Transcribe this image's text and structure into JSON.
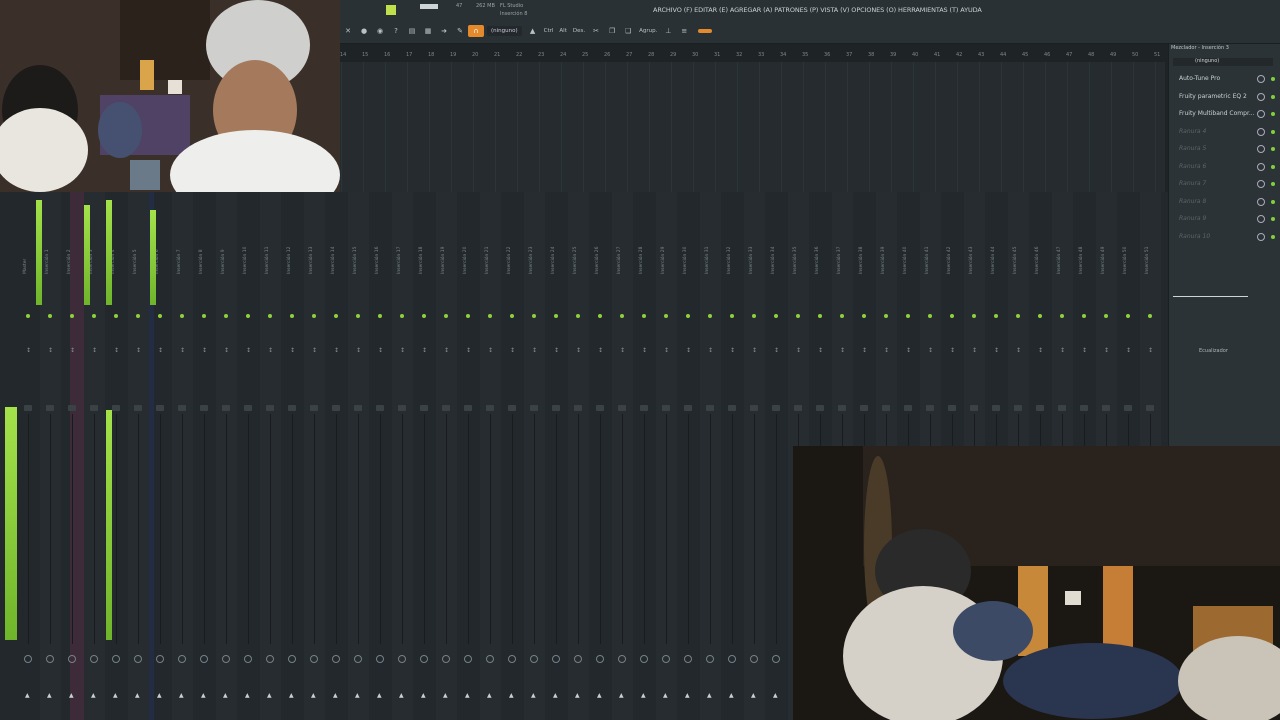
{
  "toolbar": {
    "app_name": "FL Studio",
    "insert_label": "Inserción 8",
    "cpu_value": "47",
    "ram_value": "262 MB",
    "menu_text": "ARCHIVO (F) EDITAR (E) AGREGAR (A) PATRONES (P) VISTA (V) OPCIONES (O) HERRAMIENTAS (T) AYUDA",
    "snap_label": "(ninguno)",
    "ctrl_label": "Ctrl",
    "alt_label": "Alt",
    "des_label": "Des.",
    "agrup_label": "Agrup.",
    "accent_color": "#e48a2c"
  },
  "ruler": {
    "marks": [
      "14",
      "15",
      "16",
      "17",
      "18",
      "19",
      "20",
      "21",
      "22",
      "23",
      "24",
      "25",
      "26",
      "27",
      "28",
      "29",
      "30",
      "31",
      "32",
      "33",
      "34",
      "35",
      "36",
      "37",
      "38",
      "39",
      "40",
      "41",
      "42",
      "43",
      "44",
      "45",
      "46",
      "47",
      "48",
      "49",
      "50",
      "51"
    ]
  },
  "mixer": {
    "master_label": "Master",
    "channel_prefix": "Inserción",
    "channel_count": 51,
    "meter_color": "#a4e24a"
  },
  "right_panel": {
    "title": "Mezclador - Inserción 3",
    "route": "(ninguno)",
    "slots": [
      {
        "label": "Auto-Tune Pro",
        "state": "on"
      },
      {
        "label": "Fruity parametric EQ 2",
        "state": "on"
      },
      {
        "label": "Fruity Multiband Compr...",
        "state": "on"
      },
      {
        "label": "Ranura 4",
        "state": "off"
      },
      {
        "label": "Ranura 5",
        "state": "off"
      },
      {
        "label": "Ranura 6",
        "state": "off"
      },
      {
        "label": "Ranura 7",
        "state": "off"
      },
      {
        "label": "Ranura 8",
        "state": "off"
      },
      {
        "label": "Ranura 9",
        "state": "off"
      },
      {
        "label": "Ranura 10",
        "state": "off"
      }
    ],
    "eq_label": "Ecualizador"
  }
}
